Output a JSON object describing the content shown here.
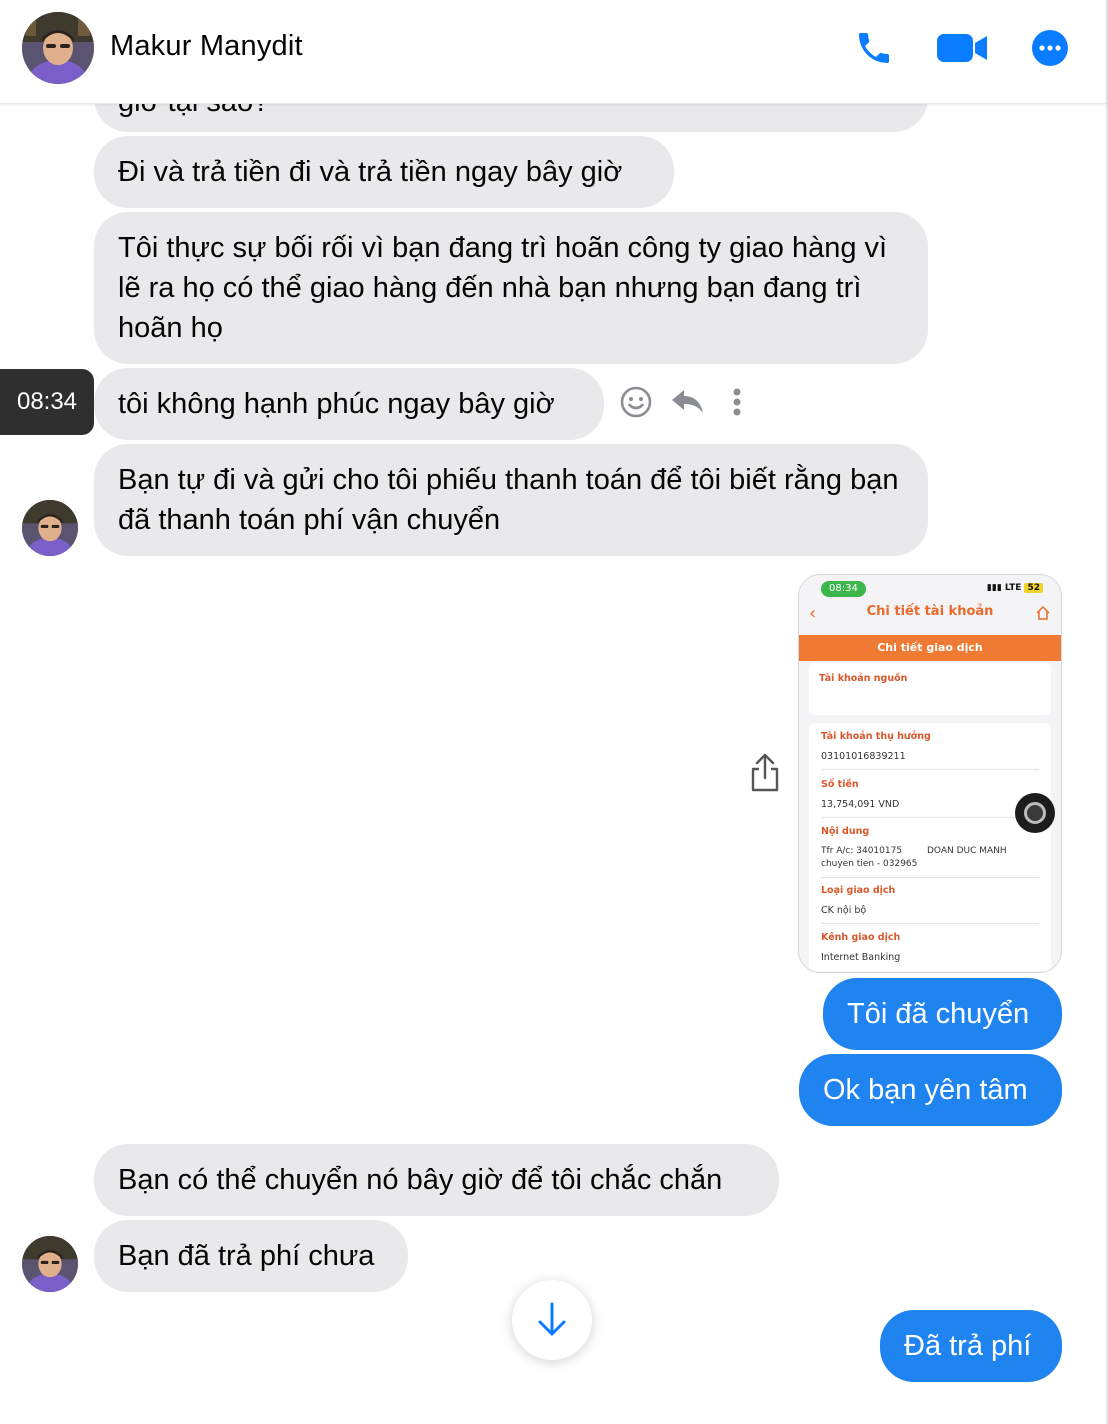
{
  "header": {
    "contact_name": "Makur Manydit",
    "icons": [
      "phone-icon",
      "video-camera-icon",
      "more-options-icon"
    ]
  },
  "messages": [
    {
      "side": "in",
      "text": "giờ tại sao?"
    },
    {
      "side": "in",
      "text": "Đi và trả tiền đi và trả tiền ngay bây giờ"
    },
    {
      "side": "in",
      "text": "Tôi thực sự bối rối vì bạn đang trì hoãn công ty giao hàng vì lẽ ra họ có thể giao hàng đến nhà bạn nhưng bạn đang trì hoãn họ"
    },
    {
      "side": "in",
      "text": "tôi không hạnh phúc ngay bây giờ"
    },
    {
      "side": "in",
      "text": "Bạn tự đi và gửi cho tôi phiếu thanh toán để tôi biết rằng bạn đã thanh toán phí vận chuyển"
    },
    {
      "side": "out",
      "text": "Tôi đã chuyển"
    },
    {
      "side": "out",
      "text": "Ok bạn yên tâm"
    },
    {
      "side": "in",
      "text": "Bạn có thể chuyển nó bây giờ để tôi chắc chắn"
    },
    {
      "side": "in",
      "text": "Bạn đã trả phí chưa"
    },
    {
      "side": "out",
      "text": "Đã trả phí"
    }
  ],
  "hover_timestamp": "08:34",
  "receipt": {
    "status_time": "08:34",
    "signal": "LTE",
    "battery": "52",
    "title": "Chi tiết tài khoản",
    "band_title": "Chi tiết giao dịch",
    "source_label": "Tài khoản nguồn",
    "beneficiary_label": "Tài khoản thụ hưởng",
    "beneficiary_value": "03101016839211",
    "amount_label": "Số tiền",
    "amount_value": "13,754,091 VND",
    "content_label": "Nội dung",
    "content_line1": "Tfr A/c: 34010175",
    "content_name": "DOAN DUC MANH",
    "content_line2": "chuyen tien - 032965",
    "type_label": "Loại giao dịch",
    "type_value": "CK nội bộ",
    "channel_label": "Kênh giao dịch",
    "channel_value": "Internet Banking"
  },
  "colors": {
    "outgoing_bubble": "#1f84f0",
    "incoming_bubble": "#e9e9eb",
    "accent": "#0a7cff"
  }
}
